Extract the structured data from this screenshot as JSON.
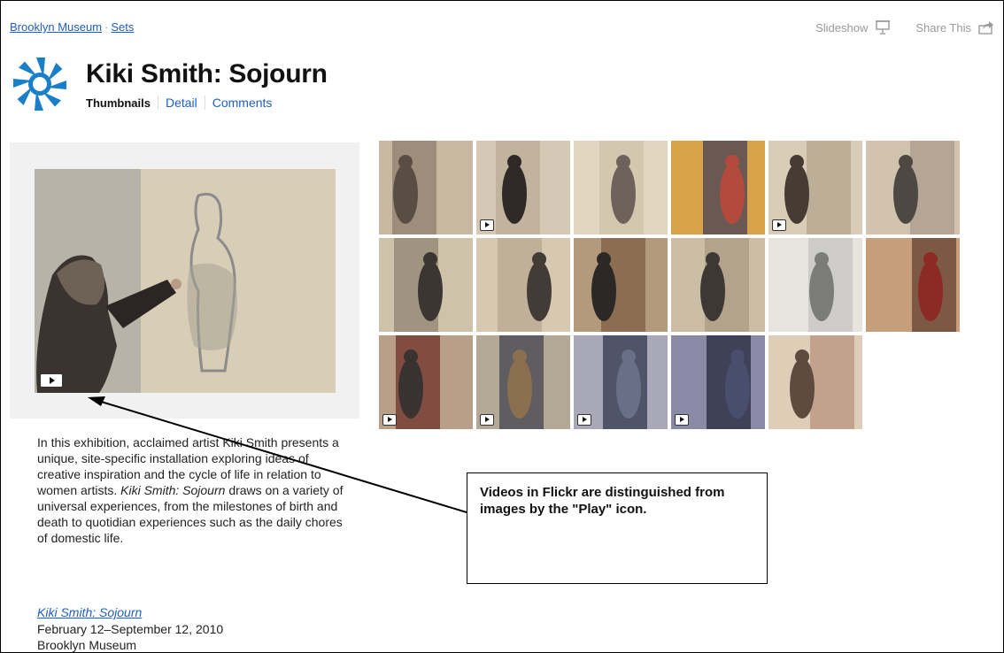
{
  "breadcrumb": {
    "museum": "Brooklyn Museum",
    "separator": "·",
    "sets": "Sets"
  },
  "toplinks": {
    "slideshow": "Slideshow",
    "share": "Share This"
  },
  "header": {
    "title": "Kiki Smith: Sojourn"
  },
  "tabs": [
    {
      "label": "Thumbnails",
      "active": true
    },
    {
      "label": "Detail",
      "active": false
    },
    {
      "label": "Comments",
      "active": false
    }
  ],
  "description": {
    "part1": "In this exhibition, acclaimed artist Kiki Smith presents a unique, site-specific installation exploring ideas of creative inspiration and the cycle of life in relation to women artists.",
    "italic": "Kiki Smith: Sojourn",
    "part2": "draws on a variety of universal experiences, from the milestones of birth and death to quotidian experiences such as the daily chores of domestic life."
  },
  "exhibition": {
    "link": "Kiki Smith: Sojourn",
    "dates": "February 12–September 12, 2010",
    "venue": "Brooklyn Museum"
  },
  "callout": {
    "text": "Videos in Flickr are distinguished from images by the \"Play\" icon."
  },
  "icons": {
    "slideshow": "projector-screen-icon",
    "share": "share-arrow-icon",
    "play": "play-icon",
    "logo": "brooklyn-museum-logo"
  },
  "colors": {
    "link": "#1f5fbf",
    "accent": "#1a7fc9"
  },
  "thumbnails": [
    {
      "video": false
    },
    {
      "video": true
    },
    {
      "video": false
    },
    {
      "video": false
    },
    {
      "video": true
    },
    {
      "video": false
    },
    {
      "video": false
    },
    {
      "video": false
    },
    {
      "video": false
    },
    {
      "video": false
    },
    {
      "video": false
    },
    {
      "video": false
    },
    {
      "video": true
    },
    {
      "video": true
    },
    {
      "video": true
    },
    {
      "video": true
    },
    {
      "video": false
    }
  ]
}
